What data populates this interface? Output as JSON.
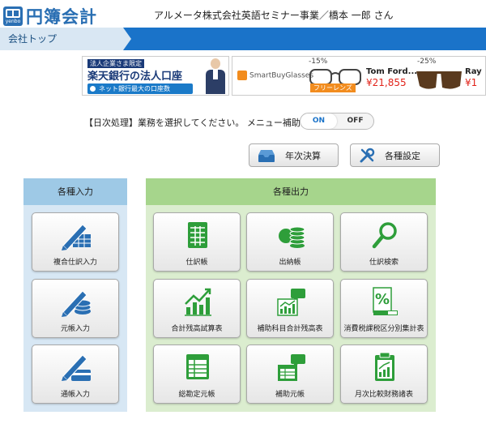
{
  "header": {
    "logo_text": "円簿会計",
    "logo_sub": "yenbo",
    "user_info": "アルメータ株式会社英語セミナー事業／橋本 一郎 さん"
  },
  "nav": {
    "breadcrumb": "会社トップ"
  },
  "ads": {
    "ad1": {
      "tag": "法人企業さま限定",
      "title": "楽天銀行の法人口座",
      "sub": "ネット銀行最大の口座数"
    },
    "ad2": {
      "logo": "SmartBuyGlasses",
      "item1_discount": "-15%",
      "item1_tag": "フリーレンズ",
      "item1_brand": "Tom Ford...",
      "item1_price": "¥21,855",
      "item2_discount": "-25%",
      "item2_brand": "Ray",
      "item2_price": "¥1"
    }
  },
  "instruction": "【日次処理】業務を選択してください。 メニュー補助",
  "toggle": {
    "on": "ON",
    "off": "OFF",
    "selected": "ON"
  },
  "top_buttons": {
    "nenji": "年次決算",
    "settings": "各種設定"
  },
  "left_panel": {
    "title": "各種入力",
    "tiles": [
      {
        "label": "複合仕訳入力",
        "icon": "pen-ledger-icon"
      },
      {
        "label": "元帳入力",
        "icon": "pen-coins-icon"
      },
      {
        "label": "通帳入力",
        "icon": "pen-card-icon"
      }
    ]
  },
  "right_panel": {
    "title": "各種出力",
    "tiles": [
      {
        "label": "仕訳帳",
        "icon": "spreadsheet-icon"
      },
      {
        "label": "出納帳",
        "icon": "coins-icon"
      },
      {
        "label": "仕訳検索",
        "icon": "magnifier-icon"
      },
      {
        "label": "合計残高試算表",
        "icon": "bar-chart-icon"
      },
      {
        "label": "補助科目合計残高表",
        "icon": "chart-bubble-icon"
      },
      {
        "label": "消費税課税区分別集計表",
        "icon": "percent-icon"
      },
      {
        "label": "総勘定元帳",
        "icon": "ledger-book-icon"
      },
      {
        "label": "補助元帳",
        "icon": "sub-ledger-icon"
      },
      {
        "label": "月次比較財務諸表",
        "icon": "clipboard-chart-icon"
      }
    ]
  },
  "colors": {
    "brand_blue": "#1a73c9",
    "input_header": "#9ec9e6",
    "output_header": "#a6d58c",
    "icon_blue": "#2a6fb3",
    "icon_green": "#2e9e3a"
  }
}
